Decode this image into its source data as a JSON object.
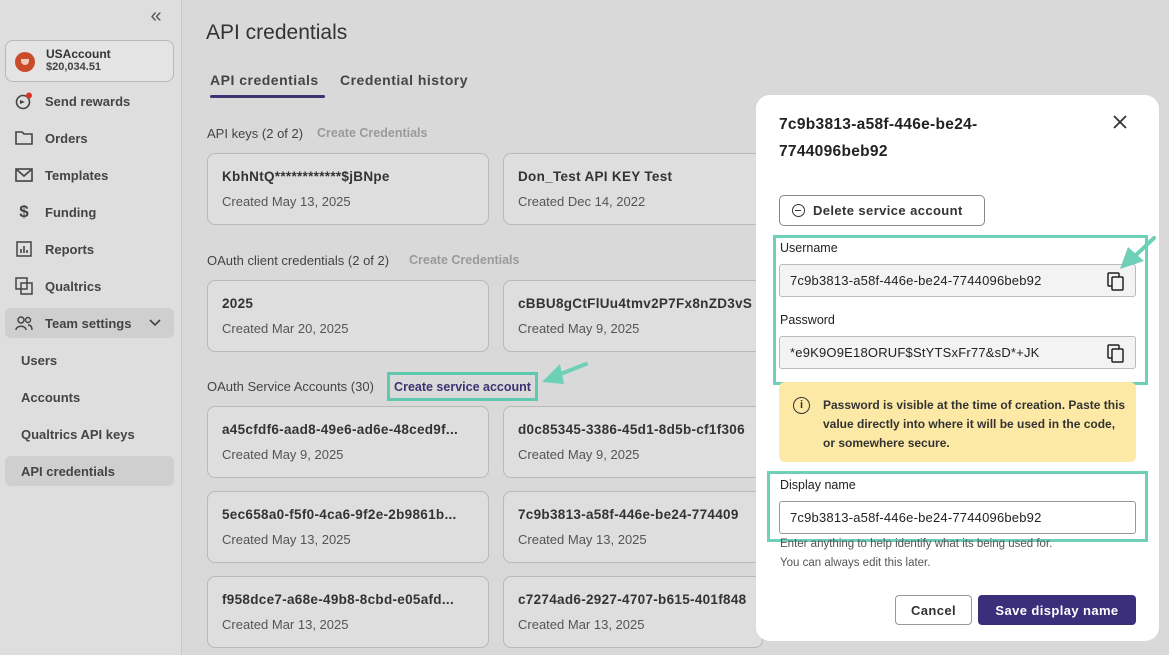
{
  "sidebar": {
    "account": {
      "name": "USAccount",
      "balance": "$20,034.51"
    },
    "items": [
      {
        "label": "Send rewards",
        "icon": "send-rewards-icon"
      },
      {
        "label": "Orders",
        "icon": "folder-icon"
      },
      {
        "label": "Templates",
        "icon": "mail-icon"
      },
      {
        "label": "Funding",
        "icon": "dollar-icon"
      },
      {
        "label": "Reports",
        "icon": "chart-icon"
      },
      {
        "label": "Qualtrics",
        "icon": "qualtrics-icon"
      },
      {
        "label": "Team settings",
        "icon": "team-icon"
      }
    ],
    "sub_items": [
      {
        "label": "Users"
      },
      {
        "label": "Accounts"
      },
      {
        "label": "Qualtrics API keys"
      },
      {
        "label": "API credentials"
      }
    ]
  },
  "page": {
    "title": "API credentials",
    "tabs": [
      {
        "label": "API credentials"
      },
      {
        "label": "Credential history"
      }
    ],
    "api_keys": {
      "label": "API keys (2 of 2)",
      "link": "Create Credentials",
      "cards": [
        {
          "title": "KbhNtQ************$jBNpe",
          "sub": "Created May 13, 2025"
        },
        {
          "title": "Don_Test API KEY Test",
          "sub": "Created Dec 14, 2022"
        }
      ]
    },
    "oauth_clients": {
      "label": "OAuth client credentials (2 of 2)",
      "link": "Create Credentials",
      "cards": [
        {
          "title": "2025",
          "sub": "Created Mar 20, 2025"
        },
        {
          "title": "cBBU8gCtFlUu4tmv2P7Fx8nZD3vS",
          "sub": "Created May 9, 2025"
        }
      ]
    },
    "service_accounts": {
      "label": "OAuth Service Accounts (30)",
      "link": "Create service account",
      "cards": [
        {
          "title": "a45cfdf6-aad8-49e6-ad6e-48ced9f...",
          "sub": "Created May 9, 2025"
        },
        {
          "title": "d0c85345-3386-45d1-8d5b-cf1f306",
          "sub": "Created May 9, 2025"
        },
        {
          "title": "5ec658a0-f5f0-4ca6-9f2e-2b9861b...",
          "sub": "Created May 13, 2025"
        },
        {
          "title": "7c9b3813-a58f-446e-be24-774409",
          "sub": "Created May 13, 2025"
        },
        {
          "title": "f958dce7-a68e-49b8-8cbd-e05afd...",
          "sub": "Created Mar 13, 2025"
        },
        {
          "title": "c7274ad6-2927-4707-b615-401f848",
          "sub": "Created Mar 13, 2025"
        }
      ]
    }
  },
  "modal": {
    "title": "7c9b3813-a58f-446e-be24-7744096beb92",
    "delete_label": "Delete service account",
    "username_label": "Username",
    "username_value": "7c9b3813-a58f-446e-be24-7744096beb92",
    "password_label": "Password",
    "password_value": "*e9K9O9E18ORUF$StYTSxFr77&sD*+JK",
    "warning": "Password is visible at the time of creation. Paste this value directly into where it will be used in the code, or somewhere secure.",
    "display_name_label": "Display name",
    "display_name_value": "7c9b3813-a58f-446e-be24-7744096beb92",
    "help_line1": "Enter anything to help identify what its being used for.",
    "help_line2": "You can always edit this later.",
    "cancel_label": "Cancel",
    "save_label": "Save display name"
  },
  "colors": {
    "accent": "#3b2f7c",
    "highlight": "#6fd0b8",
    "warning_bg": "#fde9a6"
  }
}
